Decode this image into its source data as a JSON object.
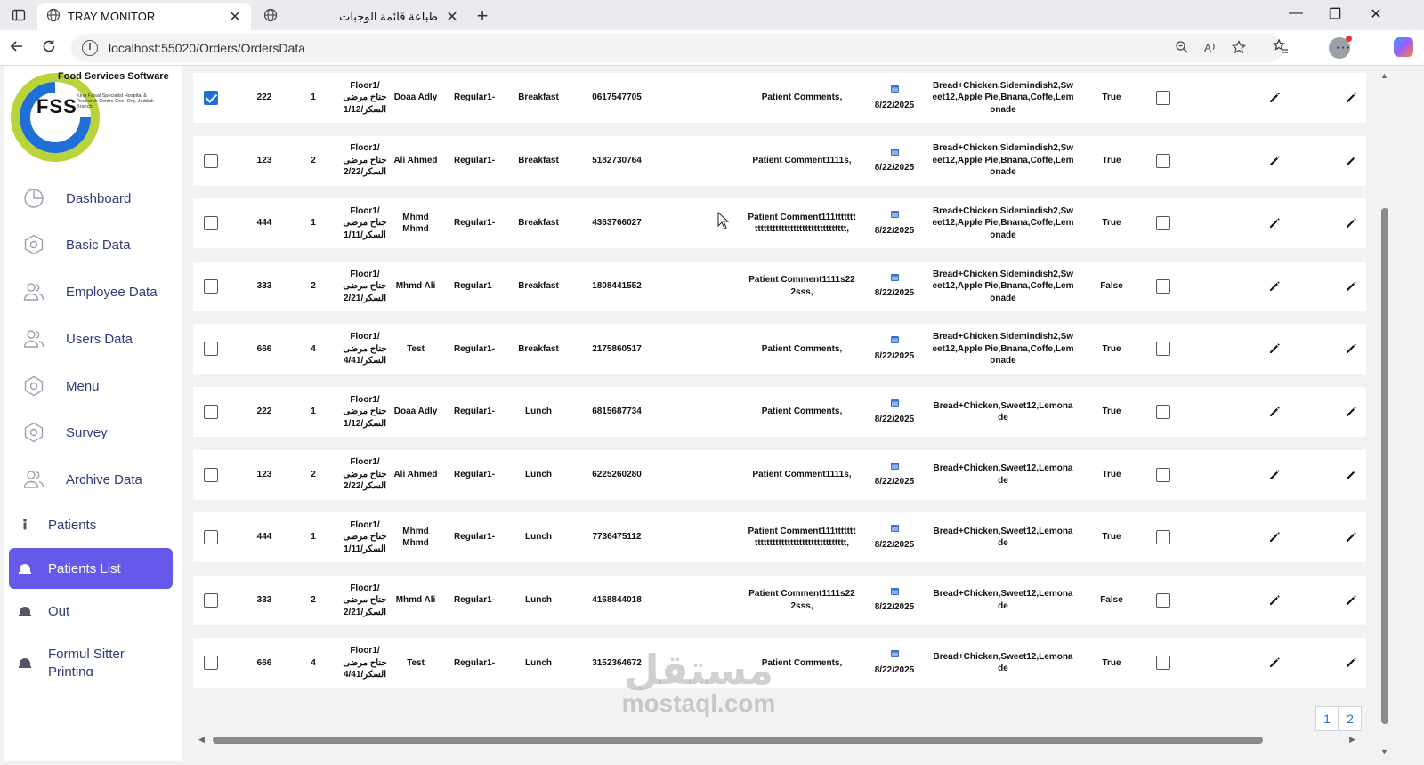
{
  "browser": {
    "tabs": [
      {
        "title": "TRAY MONITOR",
        "active": true
      },
      {
        "title": "طباعة قائمة الوجبات",
        "active": false
      }
    ],
    "new_tab_label": "+",
    "url": "localhost:55020/Orders/OrdersData",
    "info_icon_label": "i",
    "window_controls": {
      "minimize": "—",
      "restore": "❐",
      "close": "✕"
    }
  },
  "logo": {
    "title": "Food Services Software",
    "abbr": "FSS",
    "subtitle": "King Faisal Specialist Hospital & Research Centre Gen. Org. Jeddah Branch"
  },
  "sidebar": {
    "items": [
      {
        "label": "Dashboard",
        "icon": "dashboard-icon"
      },
      {
        "label": "Basic Data",
        "icon": "hexagon-icon"
      },
      {
        "label": "Employee Data",
        "icon": "users-icon"
      },
      {
        "label": "Users Data",
        "icon": "users-icon"
      },
      {
        "label": "Menu",
        "icon": "hexagon-icon"
      },
      {
        "label": "Survey",
        "icon": "hexagon-icon"
      },
      {
        "label": "Archive Data",
        "icon": "users-icon"
      },
      {
        "label": "Patients",
        "icon": "person-icon"
      },
      {
        "label": "Patients List",
        "icon": "tray-icon",
        "active": true
      },
      {
        "label": "Out",
        "icon": "tray-icon"
      },
      {
        "label": "Formul Sitter Printing",
        "icon": "tray-icon"
      }
    ]
  },
  "table": {
    "rows": [
      {
        "checked": true,
        "mrn": "222",
        "num": "1",
        "floor": [
          "Floor1/",
          "جناح مرضى",
          "السكر/1/12"
        ],
        "name": "Doaa Adly",
        "diet": "Regular1-",
        "meal": "Breakfast",
        "code": "0617547705",
        "comment": "Patient Comments,",
        "date": "8/22/2025",
        "items": "Bread+Chicken,Sidemindish2,Sweet12,Apple Pie,Bnana,Coffe,Lemonade",
        "flag": "True"
      },
      {
        "checked": false,
        "mrn": "123",
        "num": "2",
        "floor": [
          "Floor1/",
          "جناح مرضى",
          "السكر/2/22"
        ],
        "name": "Ali Ahmed",
        "diet": "Regular1-",
        "meal": "Breakfast",
        "code": "5182730764",
        "comment": "Patient Comment1111s,",
        "date": "8/22/2025",
        "items": "Bread+Chicken,Sidemindish2,Sweet12,Apple Pie,Bnana,Coffe,Lemonade",
        "flag": "True"
      },
      {
        "checked": false,
        "mrn": "444",
        "num": "1",
        "floor": [
          "Floor1/",
          "جناح مرضى",
          "السكر/1/11"
        ],
        "name": "Mhmd Mhmd",
        "diet": "Regular1-",
        "meal": "Breakfast",
        "code": "4363766027",
        "comment": "Patient Comment111tttttttttttttttttttttttttttttttttttttt,",
        "date": "8/22/2025",
        "items": "Bread+Chicken,Sidemindish2,Sweet12,Apple Pie,Bnana,Coffe,Lemonade",
        "flag": "True"
      },
      {
        "checked": false,
        "mrn": "333",
        "num": "2",
        "floor": [
          "Floor1/",
          "جناح مرضى",
          "السكر/2/21"
        ],
        "name": "Mhmd Ali",
        "diet": "Regular1-",
        "meal": "Breakfast",
        "code": "1808441552",
        "comment": "Patient Comment1111s222sss,",
        "date": "8/22/2025",
        "items": "Bread+Chicken,Sidemindish2,Sweet12,Apple Pie,Bnana,Coffe,Lemonade",
        "flag": "False"
      },
      {
        "checked": false,
        "mrn": "666",
        "num": "4",
        "floor": [
          "Floor1/",
          "جناح مرضى",
          "السكر/4/41"
        ],
        "name": "Test",
        "diet": "Regular1-",
        "meal": "Breakfast",
        "code": "2175860517",
        "comment": "Patient Comments,",
        "date": "8/22/2025",
        "items": "Bread+Chicken,Sidemindish2,Sweet12,Apple Pie,Bnana,Coffe,Lemonade",
        "flag": "True"
      },
      {
        "checked": false,
        "mrn": "222",
        "num": "1",
        "floor": [
          "Floor1/",
          "جناح مرضى",
          "السكر/1/12"
        ],
        "name": "Doaa Adly",
        "diet": "Regular1-",
        "meal": "Lunch",
        "code": "6815687734",
        "comment": "Patient Comments,",
        "date": "8/22/2025",
        "items": "Bread+Chicken,Sweet12,Lemonade",
        "flag": "True"
      },
      {
        "checked": false,
        "mrn": "123",
        "num": "2",
        "floor": [
          "Floor1/",
          "جناح مرضى",
          "السكر/2/22"
        ],
        "name": "Ali Ahmed",
        "diet": "Regular1-",
        "meal": "Lunch",
        "code": "6225260280",
        "comment": "Patient Comment1111s,",
        "date": "8/22/2025",
        "items": "Bread+Chicken,Sweet12,Lemonade",
        "flag": "True"
      },
      {
        "checked": false,
        "mrn": "444",
        "num": "1",
        "floor": [
          "Floor1/",
          "جناح مرضى",
          "السكر/1/11"
        ],
        "name": "Mhmd Mhmd",
        "diet": "Regular1-",
        "meal": "Lunch",
        "code": "7736475112",
        "comment": "Patient Comment111tttttttttttttttttttttttttttttttttttttt,",
        "date": "8/22/2025",
        "items": "Bread+Chicken,Sweet12,Lemonade",
        "flag": "True"
      },
      {
        "checked": false,
        "mrn": "333",
        "num": "2",
        "floor": [
          "Floor1/",
          "جناح مرضى",
          "السكر/2/21"
        ],
        "name": "Mhmd Ali",
        "diet": "Regular1-",
        "meal": "Lunch",
        "code": "4168844018",
        "comment": "Patient Comment1111s222sss,",
        "date": "8/22/2025",
        "items": "Bread+Chicken,Sweet12,Lemonade",
        "flag": "False"
      },
      {
        "checked": false,
        "mrn": "666",
        "num": "4",
        "floor": [
          "Floor1/",
          "جناح مرضى",
          "السكر/4/41"
        ],
        "name": "Test",
        "diet": "Regular1-",
        "meal": "Lunch",
        "code": "3152364672",
        "comment": "Patient Comments,",
        "date": "8/22/2025",
        "items": "Bread+Chicken,Sweet12,Lemonade",
        "flag": "True"
      }
    ]
  },
  "pagination": {
    "pages": [
      "1",
      "2"
    ]
  },
  "watermark": {
    "arabic": "مستقل",
    "latin": "mostaql.com"
  },
  "colors": {
    "accent": "#6658ea",
    "link": "#1f6fd6",
    "sidebar_text": "#2f3b7a"
  }
}
